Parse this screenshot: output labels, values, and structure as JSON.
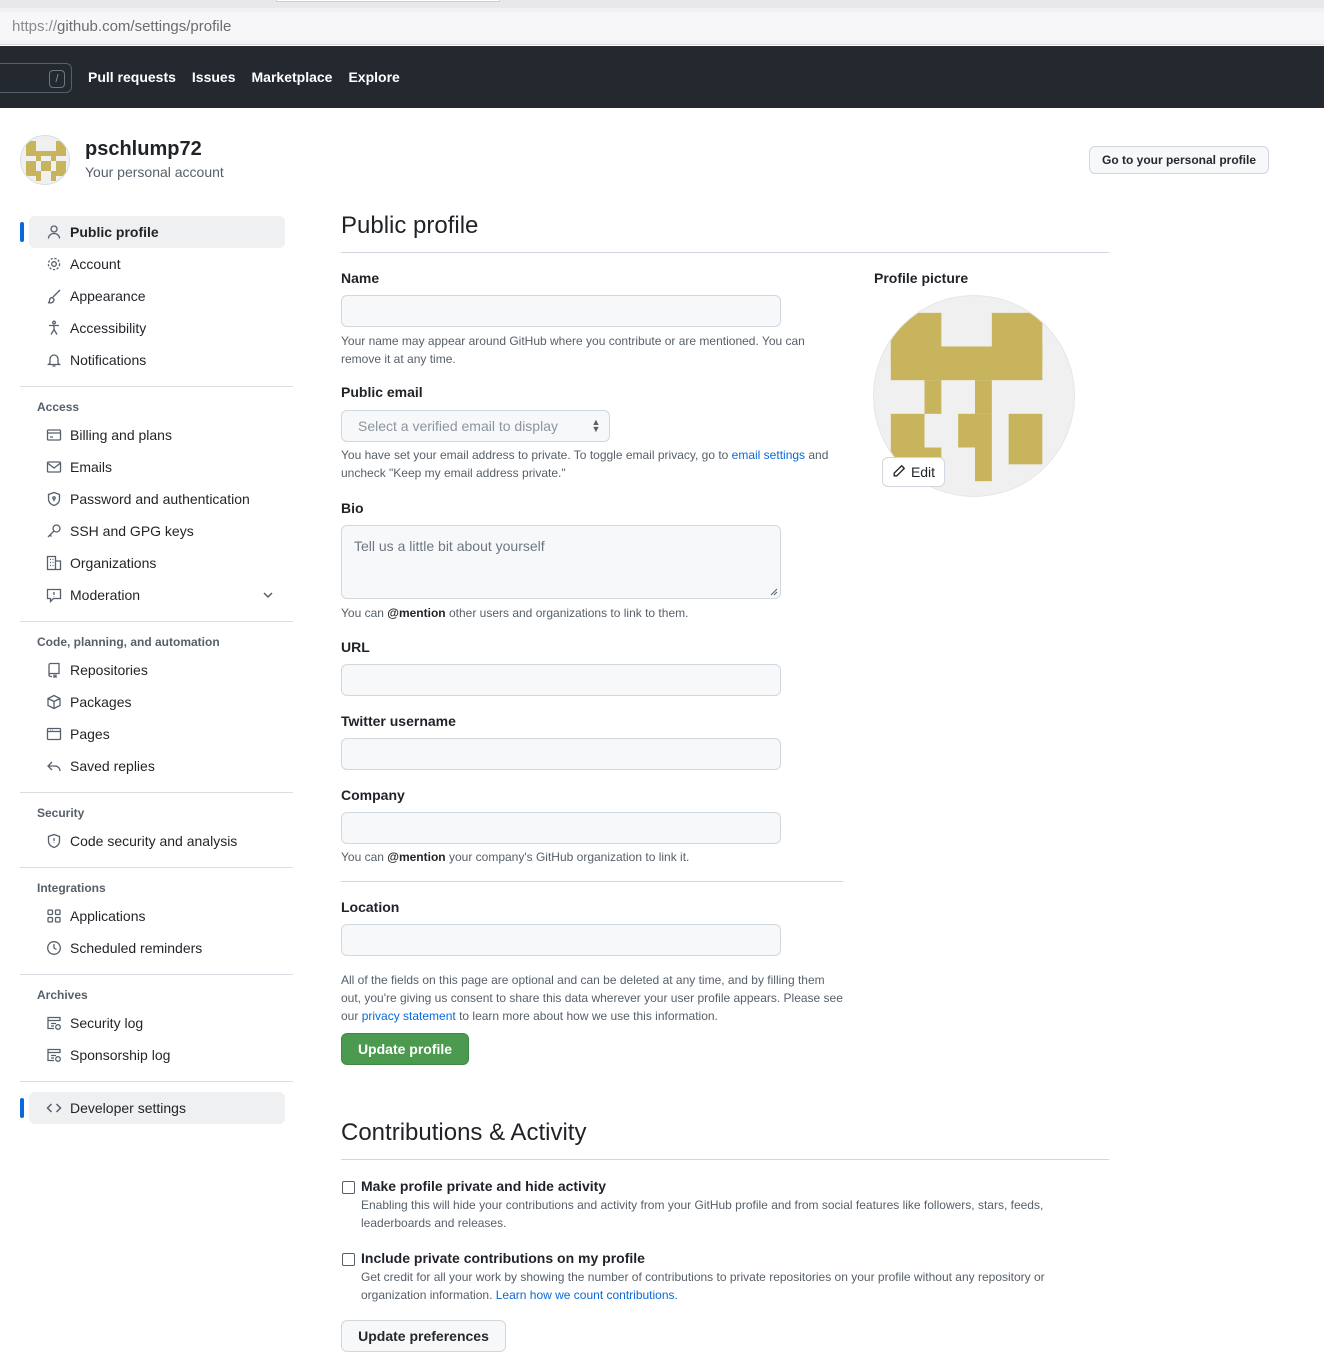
{
  "browser": {
    "url_protocol": "https://",
    "url_rest": "github.com/settings/profile"
  },
  "header": {
    "search_hint": "/",
    "nav": [
      "Pull requests",
      "Issues",
      "Marketplace",
      "Explore"
    ]
  },
  "account": {
    "username": "pschlump72",
    "subtitle": "Your personal account",
    "go_profile_label": "Go to your personal profile",
    "avatar_color": "#c8b45c"
  },
  "sidebar": {
    "top_items": [
      {
        "label": "Public profile",
        "icon": "person-icon",
        "active": true
      },
      {
        "label": "Account",
        "icon": "gear-icon"
      },
      {
        "label": "Appearance",
        "icon": "paintbrush-icon"
      },
      {
        "label": "Accessibility",
        "icon": "accessibility-icon"
      },
      {
        "label": "Notifications",
        "icon": "bell-icon"
      }
    ],
    "access_heading": "Access",
    "access_items": [
      {
        "label": "Billing and plans",
        "icon": "credit-card-icon"
      },
      {
        "label": "Emails",
        "icon": "mail-icon"
      },
      {
        "label": "Password and authentication",
        "icon": "shield-lock-icon"
      },
      {
        "label": "SSH and GPG keys",
        "icon": "key-icon"
      },
      {
        "label": "Organizations",
        "icon": "organization-icon"
      },
      {
        "label": "Moderation",
        "icon": "report-icon"
      }
    ],
    "code_heading": "Code, planning, and automation",
    "code_items": [
      {
        "label": "Repositories",
        "icon": "repo-icon"
      },
      {
        "label": "Packages",
        "icon": "package-icon"
      },
      {
        "label": "Pages",
        "icon": "browser-icon"
      },
      {
        "label": "Saved replies",
        "icon": "reply-icon"
      }
    ],
    "security_heading": "Security",
    "security_items": [
      {
        "label": "Code security and analysis",
        "icon": "shield-icon"
      }
    ],
    "integrations_heading": "Integrations",
    "integrations_items": [
      {
        "label": "Applications",
        "icon": "apps-icon"
      },
      {
        "label": "Scheduled reminders",
        "icon": "clock-icon"
      }
    ],
    "archives_heading": "Archives",
    "archives_items": [
      {
        "label": "Security log",
        "icon": "log-icon"
      },
      {
        "label": "Sponsorship log",
        "icon": "log-icon"
      }
    ],
    "developer_settings": {
      "label": "Developer settings",
      "icon": "code-icon"
    }
  },
  "public_profile": {
    "title": "Public profile",
    "name_label": "Name",
    "name_value": "",
    "name_note": "Your name may appear around GitHub where you contribute or are mentioned. You can remove it at any time.",
    "email_label": "Public email",
    "email_select": "Select a verified email to display",
    "email_note_1": "You have set your email address to private. To toggle email privacy, go to ",
    "email_note_link": "email settings",
    "email_note_2": " and uncheck \"Keep my email address private.\"",
    "bio_label": "Bio",
    "bio_placeholder": "Tell us a little bit about yourself",
    "bio_note_1": "You can ",
    "bio_note_mention": "@mention",
    "bio_note_2": " other users and organizations to link to them.",
    "url_label": "URL",
    "url_value": "",
    "twitter_label": "Twitter username",
    "twitter_value": "",
    "company_label": "Company",
    "company_value": "",
    "company_note_1": "You can ",
    "company_note_mention": "@mention",
    "company_note_2": " your company's GitHub organization to link it.",
    "location_label": "Location",
    "location_value": "",
    "footer_note_1": "All of the fields on this page are optional and can be deleted at any time, and by filling them out, you're giving us consent to share this data wherever your user profile appears. Please see our ",
    "footer_note_link": "privacy statement",
    "footer_note_2": " to learn more about how we use this information.",
    "update_button": "Update profile",
    "picture_label": "Profile picture",
    "edit_button": "Edit"
  },
  "contributions": {
    "title": "Contributions & Activity",
    "private_title": "Make profile private and hide activity",
    "private_desc": "Enabling this will hide your contributions and activity from your GitHub profile and from social features like followers, stars, feeds, leaderboards and releases.",
    "private_checked": false,
    "include_title": "Include private contributions on my profile",
    "include_desc_1": "Get credit for all your work by showing the number of contributions to private repositories on your profile without any repository or organization information. ",
    "include_desc_link": "Learn how we count contributions.",
    "include_checked": false,
    "update_button": "Update preferences"
  },
  "colors": {
    "accent": "#0969da",
    "green_button": "#4b9a4f",
    "header_bg": "#24292f",
    "avatar_gold": "#c8b45c"
  }
}
